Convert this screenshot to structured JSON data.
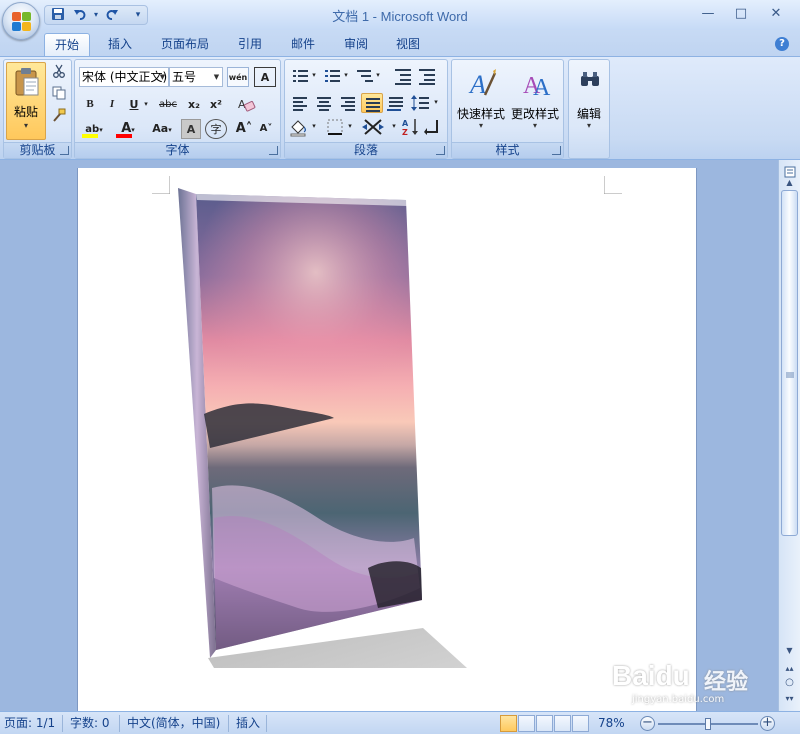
{
  "window": {
    "title": "文档 1 - Microsoft Word",
    "controls": {
      "minimize": "—",
      "maximize": "□",
      "close": "✕"
    }
  },
  "quick_access": {
    "save_icon": "save-icon",
    "undo_icon": "undo-icon",
    "redo_icon": "redo-icon",
    "customize": "▾"
  },
  "tabs": [
    {
      "label": "开始",
      "active": true
    },
    {
      "label": "插入"
    },
    {
      "label": "页面布局"
    },
    {
      "label": "引用"
    },
    {
      "label": "邮件"
    },
    {
      "label": "审阅"
    },
    {
      "label": "视图"
    }
  ],
  "help": "?",
  "clipboard": {
    "group": "剪贴板",
    "paste": "粘贴",
    "dropdown": "▾"
  },
  "font": {
    "group": "字体",
    "font_name": "宋体 (中文正文)",
    "font_size": "五号",
    "bold": "B",
    "italic": "I",
    "underline": "U",
    "strike": "abc",
    "subscript": "x₂",
    "superscript": "x²",
    "aa": "Aa",
    "grow": "A˄",
    "shrink": "A˅",
    "char_border": "A",
    "phonetic": "wén",
    "enclose": "字",
    "clear": "A",
    "highlight_color": "#ffff00",
    "font_color": "#ff0000"
  },
  "paragraph": {
    "group": "段落"
  },
  "styles": {
    "group": "样式",
    "quick_styles": "快速样式",
    "change_styles": "更改样式"
  },
  "editing": {
    "group": "编辑",
    "label": "编辑"
  },
  "statusbar": {
    "page": "页面: 1/1",
    "words": "字数: 0",
    "language": "中文(简体，中国)",
    "insert": "插入",
    "zoom": "78%",
    "zoom_level": 0.5
  },
  "watermark": {
    "brand": "Baidu",
    "label": "经验",
    "url": "jingyan.baidu.com"
  }
}
